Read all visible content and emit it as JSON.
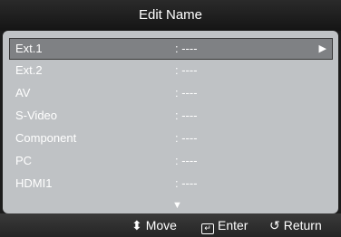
{
  "title": "Edit Name",
  "items": [
    {
      "name": "Ext.1",
      "value": ": ----"
    },
    {
      "name": "Ext.2",
      "value": ": ----"
    },
    {
      "name": "AV",
      "value": ": ----"
    },
    {
      "name": "S-Video",
      "value": ": ----"
    },
    {
      "name": "Component",
      "value": ": ----"
    },
    {
      "name": "PC",
      "value": ": ----"
    },
    {
      "name": "HDMI1",
      "value": ": ----"
    }
  ],
  "selected_index": 0,
  "icons": {
    "selected_arrow": "right-triangle-icon",
    "more_below": "down-triangle-icon",
    "move": "up-down-arrow-icon",
    "enter": "enter-icon",
    "return": "return-icon"
  },
  "footer": {
    "move_label": "Move",
    "enter_label": "Enter",
    "return_label": "Return"
  },
  "colors": {
    "panel": "#bfc2c5",
    "selection": "#7f8184",
    "title_bar": "#1f1f1f"
  }
}
